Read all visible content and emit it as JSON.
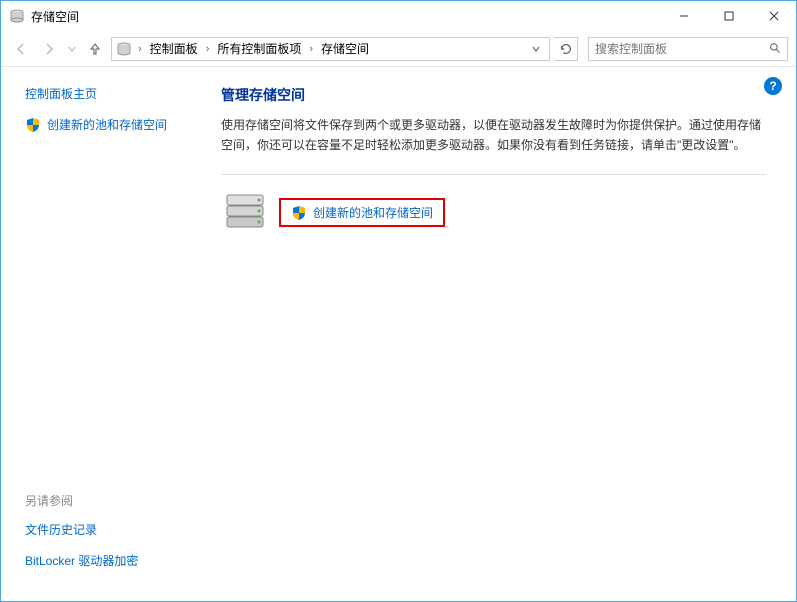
{
  "titlebar": {
    "title": "存储空间"
  },
  "breadcrumb": {
    "item1": "控制面板",
    "item2": "所有控制面板项",
    "item3": "存储空间"
  },
  "search": {
    "placeholder": "搜索控制面板"
  },
  "sidebar": {
    "home": "控制面板主页",
    "create": "创建新的池和存储空间"
  },
  "see_also": {
    "header": "另请参阅",
    "file_history": "文件历史记录",
    "bitlocker": "BitLocker 驱动器加密"
  },
  "main": {
    "heading": "管理存储空间",
    "description": "使用存储空间将文件保存到两个或更多驱动器，以便在驱动器发生故障时为你提供保护。通过使用存储空间，你还可以在容量不足时轻松添加更多驱动器。如果你没有看到任务链接，请单击\"更改设置\"。",
    "action_link": "创建新的池和存储空间"
  },
  "help": {
    "symbol": "?"
  }
}
